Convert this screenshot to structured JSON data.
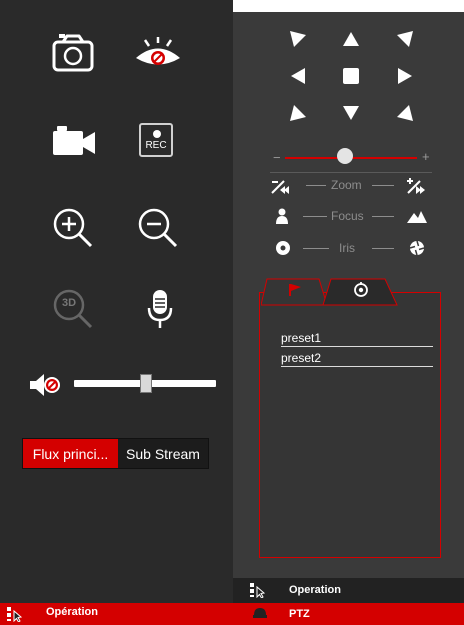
{
  "left_panel": {
    "icons": {
      "snapshot": "camera-icon",
      "privacy": "eye-blocked-icon",
      "record_video": "video-camera-icon",
      "rec": "rec-icon",
      "zoom_in": "zoom-in-icon",
      "zoom_out": "zoom-out-icon",
      "view_3d": "zoom-3d-icon",
      "microphone": "microphone-icon",
      "mute": "speaker-muted-icon"
    },
    "rec_label": "REC",
    "three_d_label": "3D",
    "volume_level": 0.5,
    "streams": {
      "main_label": "Flux princi...",
      "sub_label": "Sub Stream",
      "selected": "main"
    },
    "footer_label": "Opération"
  },
  "right_panel": {
    "ptz_arrows": [
      "up-left",
      "up",
      "up-right",
      "left",
      "stop",
      "right",
      "down-left",
      "down",
      "down-right"
    ],
    "speed_minus": "−",
    "speed_plus": "+",
    "speed_level": 0.48,
    "controls": {
      "zoom_label": "Zoom",
      "focus_label": "Focus",
      "iris_label": "Iris"
    },
    "tabs": [
      {
        "name": "preset-tab",
        "icon": "flag-icon",
        "active": true
      },
      {
        "name": "cruise-tab",
        "icon": "patrol-icon",
        "active": false
      }
    ],
    "presets": [
      "preset1",
      "preset2"
    ],
    "footer_operation_label": "Operation",
    "footer_ptz_label": "PTZ"
  },
  "colors": {
    "accent": "#d40000",
    "panel_left": "#2a2a2a",
    "panel_right": "#3a3a3a"
  }
}
